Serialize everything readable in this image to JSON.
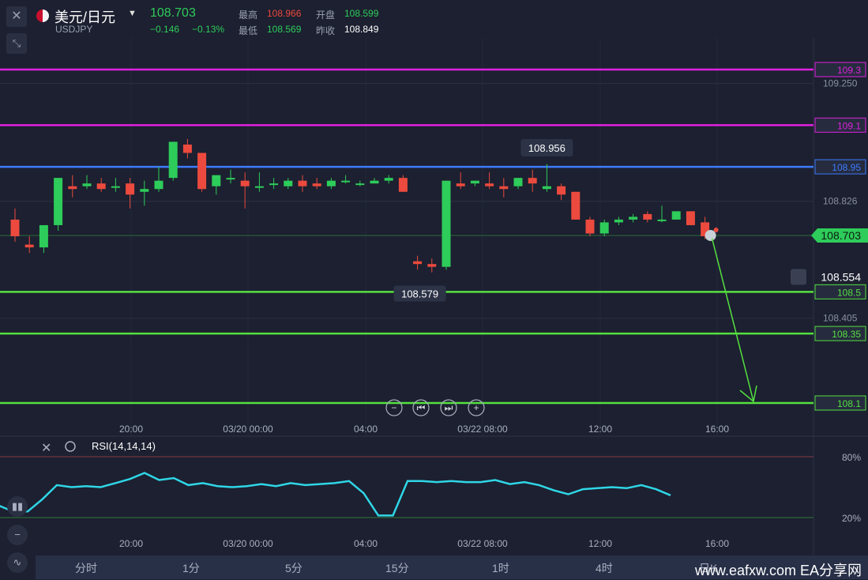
{
  "header": {
    "pair_name": "美元/日元",
    "pair_code": "USDJPY",
    "last": "108.703",
    "change": "−0.146",
    "change_pct": "−0.13%",
    "high_label": "最高",
    "high": "108.966",
    "open_label": "开盘",
    "open": "108.599",
    "low_label": "最低",
    "low": "108.569",
    "prev_label": "昨收",
    "prev": "108.849"
  },
  "colors": {
    "up": "#2ecc5a",
    "down": "#ec4a3e",
    "magenta": "#e020e0",
    "blue": "#3d7bff",
    "green_line": "#55e040",
    "rsi": "#2fd6e6",
    "bg": "#1c2030"
  },
  "chart_data": [
    {
      "type": "candlestick",
      "y_ticks": [
        "109.250",
        "108.826",
        "108.405"
      ],
      "x_ticks": [
        "20:00",
        "03/20 00:00",
        "04:00",
        "03/22 08:00",
        "12:00",
        "16:00"
      ],
      "horizontal_lines": [
        {
          "label": "109.3",
          "value": 109.3,
          "color": "magenta"
        },
        {
          "label": "109.1",
          "value": 109.1,
          "color": "magenta"
        },
        {
          "label": "108.95",
          "value": 108.95,
          "color": "blue"
        },
        {
          "label": "108.5",
          "value": 108.5,
          "color": "green"
        },
        {
          "label": "108.35",
          "value": 108.35,
          "color": "green"
        },
        {
          "label": "108.1",
          "value": 108.1,
          "color": "green"
        }
      ],
      "current_price": "108.703",
      "alert_price": "108.554",
      "max_label": "108.956",
      "min_label": "108.579",
      "candles": [
        {
          "o": 108.76,
          "h": 108.8,
          "c": 108.7,
          "l": 108.68
        },
        {
          "o": 108.67,
          "h": 108.7,
          "c": 108.66,
          "l": 108.64
        },
        {
          "o": 108.66,
          "h": 108.74,
          "c": 108.74,
          "l": 108.64
        },
        {
          "o": 108.74,
          "h": 108.91,
          "c": 108.91,
          "l": 108.72
        },
        {
          "o": 108.88,
          "h": 108.92,
          "c": 108.87,
          "l": 108.84
        },
        {
          "o": 108.88,
          "h": 108.92,
          "c": 108.89,
          "l": 108.87
        },
        {
          "o": 108.89,
          "h": 108.91,
          "c": 108.87,
          "l": 108.86
        },
        {
          "o": 108.88,
          "h": 108.91,
          "c": 108.88,
          "l": 108.86
        },
        {
          "o": 108.89,
          "h": 108.91,
          "c": 108.85,
          "l": 108.8
        },
        {
          "o": 108.86,
          "h": 108.9,
          "c": 108.87,
          "l": 108.81
        },
        {
          "o": 108.87,
          "h": 108.95,
          "c": 108.9,
          "l": 108.86
        },
        {
          "o": 108.91,
          "h": 109.04,
          "c": 109.04,
          "l": 108.9
        },
        {
          "o": 109.03,
          "h": 109.05,
          "c": 109.0,
          "l": 108.98
        },
        {
          "o": 109.0,
          "h": 109.0,
          "c": 108.87,
          "l": 108.86
        },
        {
          "o": 108.88,
          "h": 108.91,
          "c": 108.92,
          "l": 108.85
        },
        {
          "o": 108.91,
          "h": 108.94,
          "c": 108.91,
          "l": 108.89
        },
        {
          "o": 108.9,
          "h": 108.93,
          "c": 108.88,
          "l": 108.8
        },
        {
          "o": 108.88,
          "h": 108.93,
          "c": 108.88,
          "l": 108.86
        },
        {
          "o": 108.89,
          "h": 108.91,
          "c": 108.89,
          "l": 108.87
        },
        {
          "o": 108.88,
          "h": 108.91,
          "c": 108.9,
          "l": 108.87
        },
        {
          "o": 108.9,
          "h": 108.92,
          "c": 108.88,
          "l": 108.86
        },
        {
          "o": 108.89,
          "h": 108.91,
          "c": 108.88,
          "l": 108.87
        },
        {
          "o": 108.88,
          "h": 108.91,
          "c": 108.9,
          "l": 108.87
        },
        {
          "o": 108.9,
          "h": 108.92,
          "c": 108.9,
          "l": 108.89
        },
        {
          "o": 108.89,
          "h": 108.9,
          "c": 108.89,
          "l": 108.88
        },
        {
          "o": 108.89,
          "h": 108.91,
          "c": 108.9,
          "l": 108.89
        },
        {
          "o": 108.9,
          "h": 108.92,
          "c": 108.91,
          "l": 108.89
        },
        {
          "o": 108.91,
          "h": 108.92,
          "c": 108.86,
          "l": 108.86
        },
        {
          "o": 108.61,
          "h": 108.63,
          "c": 108.6,
          "l": 108.58
        },
        {
          "o": 108.6,
          "h": 108.62,
          "c": 108.59,
          "l": 108.57
        },
        {
          "o": 108.59,
          "h": 108.9,
          "c": 108.9,
          "l": 108.58
        },
        {
          "o": 108.89,
          "h": 108.93,
          "c": 108.88,
          "l": 108.87
        },
        {
          "o": 108.89,
          "h": 108.9,
          "c": 108.9,
          "l": 108.88
        },
        {
          "o": 108.89,
          "h": 108.93,
          "c": 108.88,
          "l": 108.87
        },
        {
          "o": 108.88,
          "h": 108.91,
          "c": 108.87,
          "l": 108.84
        },
        {
          "o": 108.88,
          "h": 108.91,
          "c": 108.91,
          "l": 108.87
        },
        {
          "o": 108.91,
          "h": 108.94,
          "c": 108.89,
          "l": 108.86
        },
        {
          "o": 108.87,
          "h": 108.96,
          "c": 108.88,
          "l": 108.86
        },
        {
          "o": 108.88,
          "h": 108.89,
          "c": 108.85,
          "l": 108.83
        },
        {
          "o": 108.86,
          "h": 108.86,
          "c": 108.76,
          "l": 108.76
        },
        {
          "o": 108.76,
          "h": 108.77,
          "c": 108.71,
          "l": 108.7
        },
        {
          "o": 108.71,
          "h": 108.76,
          "c": 108.75,
          "l": 108.7
        },
        {
          "o": 108.75,
          "h": 108.77,
          "c": 108.76,
          "l": 108.74
        },
        {
          "o": 108.76,
          "h": 108.78,
          "c": 108.77,
          "l": 108.75
        },
        {
          "o": 108.78,
          "h": 108.79,
          "c": 108.76,
          "l": 108.75
        },
        {
          "o": 108.76,
          "h": 108.81,
          "c": 108.76,
          "l": 108.75
        },
        {
          "o": 108.76,
          "h": 108.79,
          "c": 108.79,
          "l": 108.76
        },
        {
          "o": 108.79,
          "h": 108.78,
          "c": 108.74,
          "l": 108.74
        },
        {
          "o": 108.75,
          "h": 108.77,
          "c": 108.7,
          "l": 108.69
        }
      ]
    },
    {
      "type": "line",
      "title": "RSI(14,14,14)",
      "y_ticks": [
        "80%",
        "20%"
      ],
      "x_ticks": [
        "20:00",
        "03/20 00:00",
        "04:00",
        "03/22 08:00",
        "12:00",
        "16:00"
      ],
      "values": [
        32,
        26,
        26,
        38,
        52,
        50,
        51,
        50,
        54,
        58,
        64,
        57,
        59,
        52,
        54,
        51,
        50,
        51,
        53,
        51,
        54,
        52,
        53,
        54,
        56,
        44,
        22,
        22,
        56,
        56,
        55,
        56,
        55,
        55,
        57,
        53,
        55,
        52,
        47,
        43,
        48,
        49,
        50,
        49,
        52,
        48,
        42
      ]
    }
  ],
  "controls": {
    "zoom_out": "−",
    "prev": "⏮",
    "next": "⏭",
    "zoom_in": "+"
  },
  "tabs": [
    "分时",
    "1分",
    "5分",
    "15分",
    "1时",
    "4时",
    "日K"
  ],
  "watermark": {
    "site": "www.eafxw.com  EA分享网"
  }
}
